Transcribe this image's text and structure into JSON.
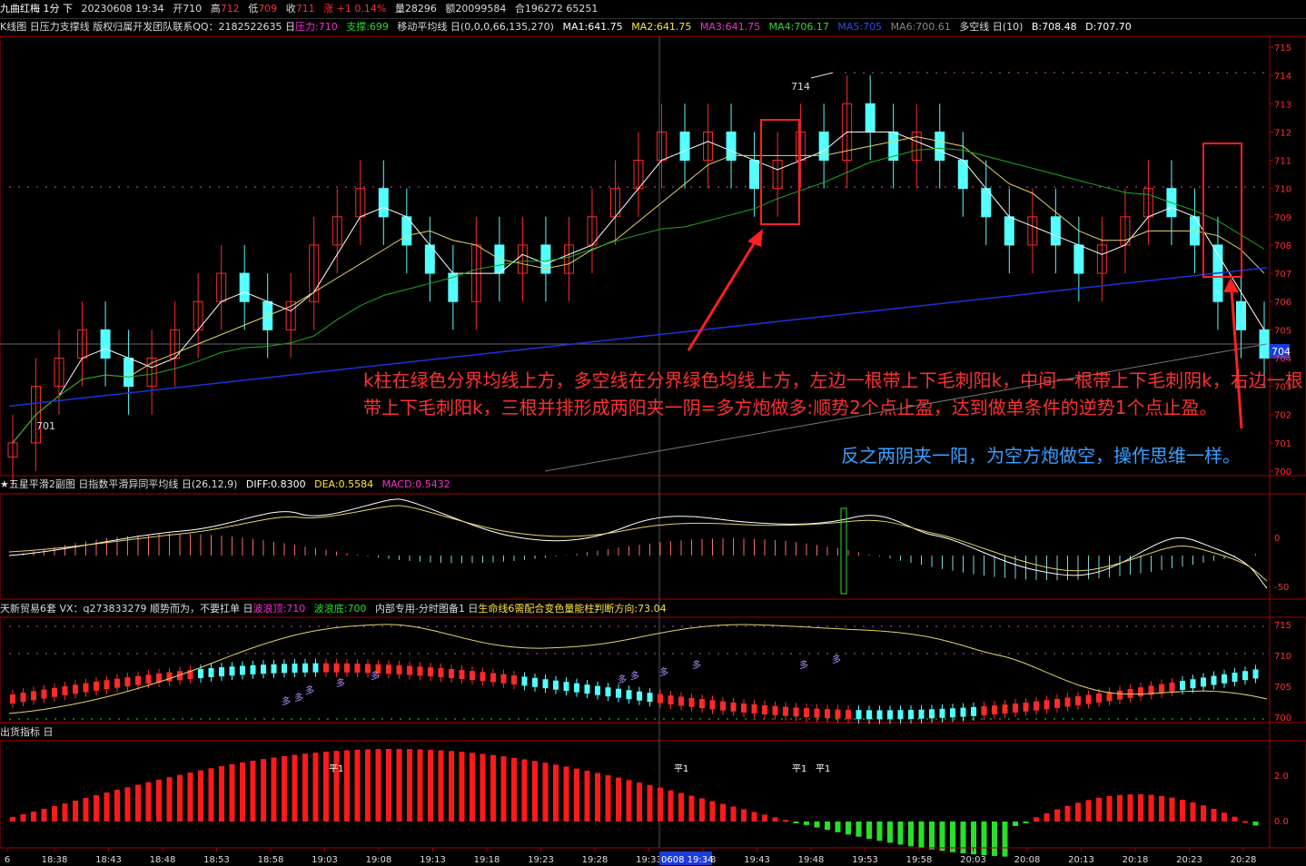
{
  "title_bar": {
    "symbol": "九曲红梅 1分 下",
    "datetime": "20230608 19:34",
    "open_label": "开",
    "open": "710",
    "high_label": "高",
    "high": "712",
    "low_label": "低",
    "low": "709",
    "close_label": "收",
    "close": "711",
    "change": "涨 +1 0.14%",
    "volume": "量28296",
    "amount": "额20099584",
    "position": "合196272 65251"
  },
  "kline": {
    "header_prefix": "K线图 日压力支撑线 版权归属开发团队联系QQ：2182522635 日",
    "pressure": "压力:710",
    "support": "支撑:699",
    "ma_label": "移动平均线 日(0,0,0,66,135,270)",
    "ma1": "MA1:641.75",
    "ma2": "MA2:641.75",
    "ma3": "MA3:641.75",
    "ma4": "MA4:706.17",
    "ma5": "MA5:705",
    "ma6": "MA6:700.61",
    "trend_line": "多空线 日(10)",
    "b_value": "B:708.48",
    "d_value": "D:707.70",
    "high_marker": "714",
    "low_marker": "701",
    "price_tag": "704",
    "y_ticks": [
      "715",
      "714",
      "713",
      "712",
      "711",
      "710",
      "709",
      "708",
      "707",
      "706",
      "705",
      "704",
      "703",
      "702",
      "701",
      "700"
    ]
  },
  "annotations": {
    "red_text": "k柱在绿色分界均线上方，多空线在分界绿色均线上方，左边一根带上下毛刺阳k，中间一根带上下毛刺阴k，右边一根带上下毛刺阳k，三根并排形成两阳夹一阴=多方炮做多:顺势2个点止盈，达到做单条件的逆势1个点止盈。",
    "blue_text": "反之两阴夹一阳，为空方炮做空，操作思维一样。"
  },
  "macd": {
    "header_prefix": "★五星平滑2副图 日指数平滑异同平均线 日(26,12,9)",
    "diff": "DIFF:0.8300",
    "dea": "DEA:0.5584",
    "macd": "MACD:0.5432",
    "y_ticks": [
      "0",
      "-50"
    ]
  },
  "wave": {
    "header_prefix": "天新贸易6套 VX：q273833279  顺势而为，不要扛单 日",
    "wave_top": "波浪顶:710",
    "wave_bottom": "波浪底:700",
    "suffix": "内部专用-分时图备1 日",
    "life_line": "生命线6需配合变色量能柱判断方向:73.04",
    "y_ticks": [
      "715",
      "710",
      "705",
      "700"
    ],
    "marker_text": "多"
  },
  "sell": {
    "header": "出货指标 日",
    "y_ticks": [
      "2.0",
      "0.0"
    ],
    "marker_text": "平1"
  },
  "time_axis": {
    "labels": [
      "6",
      "18:38",
      "18:43",
      "18:48",
      "18:53",
      "18:58",
      "19:03",
      "19:08",
      "19:13",
      "19:18",
      "19:23",
      "19:28",
      "19:33",
      "19:38",
      "19:43",
      "19:48",
      "19:53",
      "19:58",
      "20:03",
      "20:08",
      "20:13",
      "20:18",
      "20:23",
      "20:28"
    ],
    "cursor": "0608 19:34"
  },
  "colors": {
    "up": "#ff2a2a",
    "down": "#54ffff",
    "ma_green": "#1fa81f",
    "ma_blue": "#1b35d8",
    "ma_gray": "#777777",
    "annotation_red": "#ff3030",
    "annotation_blue": "#3aa0ff"
  },
  "chart_data": {
    "type": "candlestick",
    "title": "九曲红梅 1分",
    "x_label": "",
    "y_label": "",
    "ylim": [
      700,
      715
    ],
    "x_start": "18:33",
    "x_end": "20:30",
    "series": [
      {
        "name": "close",
        "values": [
          701,
          703,
          704,
          705,
          704,
          703,
          704,
          705,
          706,
          707,
          706,
          705,
          706,
          708,
          709,
          710,
          709,
          708,
          707,
          706,
          708,
          707,
          708,
          707,
          708,
          709,
          710,
          711,
          712,
          711,
          712,
          711,
          710,
          711,
          712,
          711,
          713,
          712,
          711,
          712,
          711,
          710,
          709,
          708,
          709,
          708,
          707,
          708,
          709,
          710,
          709,
          708,
          706,
          705,
          704
        ]
      }
    ]
  }
}
